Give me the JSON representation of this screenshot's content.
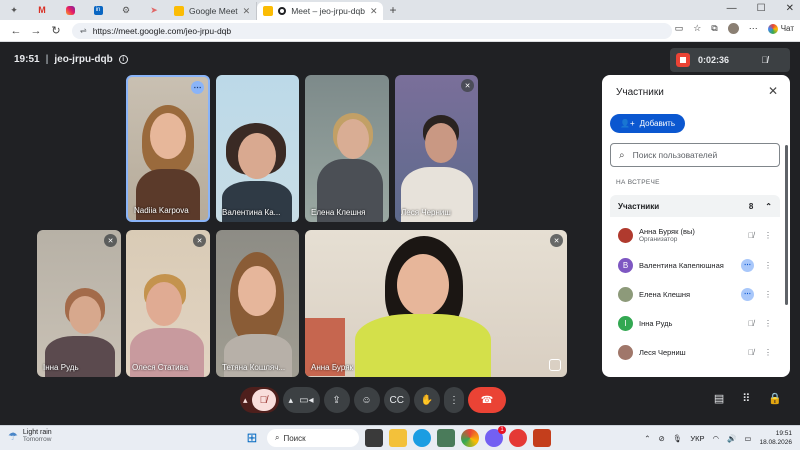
{
  "browser": {
    "tabs": [
      {
        "label": "",
        "icon": "pinned-app-icon"
      },
      {
        "label": "",
        "icon": "gmail-icon"
      },
      {
        "label": "",
        "icon": "instagram-icon"
      },
      {
        "label": "",
        "icon": "linkedin-icon"
      },
      {
        "label": "",
        "icon": "settings-icon"
      },
      {
        "label": "",
        "icon": "cursor-icon"
      },
      {
        "label": "Google Meet",
        "icon": "meet-icon"
      },
      {
        "label": "Meet – jeo-jrpu-dqb",
        "icon": "recording-icon",
        "active": true
      }
    ],
    "url": "https://meet.google.com/jeo-jrpu-dqb",
    "chat_label": "Чат"
  },
  "meeting": {
    "time": "19:51",
    "code": "jeo-jrpu-dqb",
    "recording_time": "0:02:36"
  },
  "tiles": [
    {
      "name": "Nadiia Karpova"
    },
    {
      "name": "Валентина Ка..."
    },
    {
      "name": "Елена Клешня"
    },
    {
      "name": "Леся Черниш"
    },
    {
      "name": "Інна Рудь"
    },
    {
      "name": "Олеся Статива"
    },
    {
      "name": "Тетяна Кошляч..."
    },
    {
      "name": "Анна Буряк"
    }
  ],
  "panel": {
    "title": "Участники",
    "add_label": "Добавить",
    "search_placeholder": "Поиск пользователей",
    "section_label": "НА ВСТРЕЧЕ",
    "group_label": "Участники",
    "group_count": "8",
    "participants": [
      {
        "name": "Анна Буряк (вы)",
        "sub": "Организатор",
        "avatar": "",
        "color": "#b03a2e"
      },
      {
        "name": "Валентина Капелюшная",
        "sub": "",
        "avatar": "В",
        "color": "#7e57c2"
      },
      {
        "name": "Елена Клешня",
        "sub": "",
        "avatar": "",
        "color": "#8d9a7a"
      },
      {
        "name": "Інна Рудь",
        "sub": "",
        "avatar": "І",
        "color": "#33a852"
      },
      {
        "name": "Леся Черниш",
        "sub": "",
        "avatar": "",
        "color": "#a0776a"
      }
    ]
  },
  "taskbar": {
    "weather_title": "Light rain",
    "weather_sub": "Tomorrow",
    "search_label": "Поиск",
    "lang": "УКР",
    "time": "19:51",
    "date": "18.08.2026",
    "badge": "1"
  },
  "colors": {
    "meet_bg": "#202124",
    "accent": "#0b57d0",
    "hangup": "#ea4335",
    "recording": "#ea4335"
  }
}
